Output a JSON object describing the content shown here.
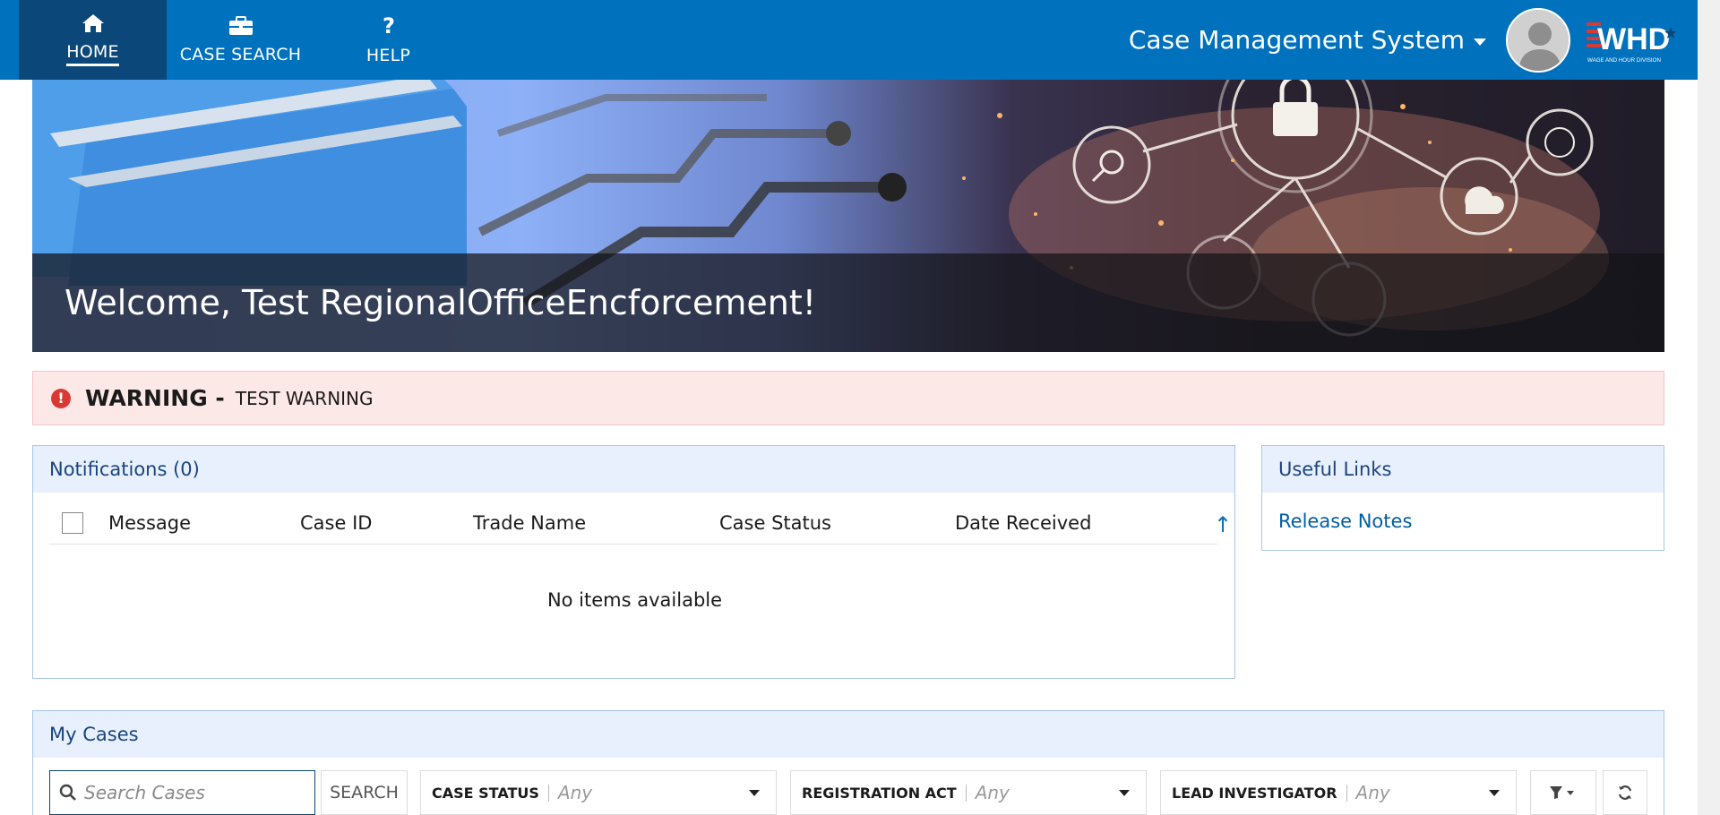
{
  "nav": {
    "items": [
      {
        "label": "HOME",
        "icon": "home-icon"
      },
      {
        "label": "CASE SEARCH",
        "icon": "briefcase-icon"
      },
      {
        "label": "HELP",
        "icon": "question-icon"
      }
    ],
    "app_title": "Case Management System",
    "logo_text": "WHD",
    "logo_subtext": "WAGE AND HOUR DIVISION"
  },
  "hero": {
    "welcome": "Welcome, Test RegionalOfficeEncforcement!"
  },
  "warning": {
    "title": "WARNING -",
    "text": "TEST WARNING"
  },
  "notifications": {
    "title": "Notifications (0)",
    "columns": [
      "Message",
      "Case ID",
      "Trade Name",
      "Case Status",
      "Date Received"
    ],
    "empty_text": "No items available"
  },
  "useful_links": {
    "title": "Useful Links",
    "links": [
      "Release Notes"
    ]
  },
  "my_cases": {
    "title": "My Cases",
    "search_placeholder": "Search Cases",
    "search_button": "SEARCH",
    "filters": [
      {
        "label": "CASE STATUS",
        "value": "Any"
      },
      {
        "label": "REGISTRATION ACT",
        "value": "Any"
      },
      {
        "label": "LEAD INVESTIGATOR",
        "value": "Any"
      }
    ]
  },
  "colors": {
    "nav_bg": "#0071bc",
    "nav_active": "#0b4778",
    "panel_header": "#e7f0fc",
    "warning_bg": "#fde8e8",
    "link": "#005ea2"
  }
}
